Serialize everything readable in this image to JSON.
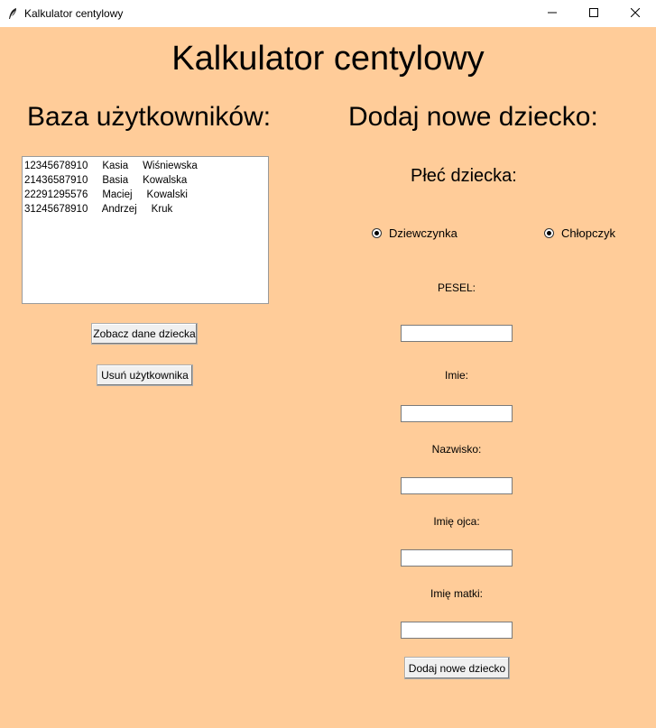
{
  "window": {
    "title": "Kalkulator centylowy",
    "app_icon": "feather-icon",
    "controls": [
      "minimize-icon",
      "maximize-icon",
      "close-icon"
    ]
  },
  "main_title": "Kalkulator centylowy",
  "users_panel": {
    "heading": "Baza użytkowników:",
    "list": [
      "12345678910     Kasia     Wiśniewska",
      "21436587910     Basia     Kowalska",
      "22291295576     Maciej     Kowalski",
      "31245678910     Andrzej     Kruk"
    ],
    "view_button": "Zobacz dane dziecka",
    "delete_button": "Usuń użytkownika"
  },
  "add_panel": {
    "heading": "Dodaj nowe dziecko:",
    "sex_label": "Płeć dziecka:",
    "radio_girl": "Dziewczynka",
    "radio_boy": "Chłopczyk",
    "pesel_label": "PESEL:",
    "first_name_label": "Imie:",
    "last_name_label": "Nazwisko:",
    "father_name_label": "Imię ojca:",
    "mother_name_label": "Imię matki:",
    "pesel_value": "",
    "first_name_value": "",
    "last_name_value": "",
    "father_name_value": "",
    "mother_name_value": "",
    "add_button": "Dodaj nowe dziecko"
  },
  "colors": {
    "background": "#FFCC99"
  }
}
